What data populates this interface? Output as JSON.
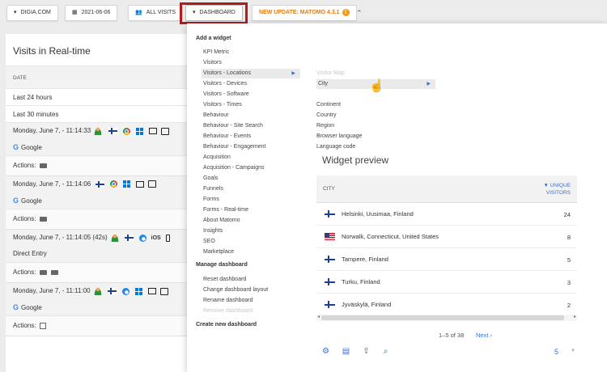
{
  "topbar": {
    "site": "DIGIA.COM",
    "date": "2021-06-06",
    "segment": "ALL VISITS",
    "dashboard": "DASHBOARD",
    "update": "NEW UPDATE: MATOMO 4.3.1",
    "update_badge": "!",
    "collapse_icon": "double-caret-up-icon",
    "colors": {
      "highlight": "#b01c1c",
      "update": "#e57b10"
    }
  },
  "visits": {
    "title": "Visits in Real-time",
    "column": "DATE",
    "rows": [
      "Last 24 hours",
      "Last 30 minutes"
    ],
    "entries": [
      {
        "time": "Monday, June 7, - 11:14:33",
        "referrer": "Google",
        "actions_label": "Actions:"
      },
      {
        "time": "Monday, June 7, - 11:14:06",
        "referrer": "Google",
        "actions_label": "Actions:"
      },
      {
        "time": "Monday, June 7, - 11:14:05 (42s)",
        "referrer": "Direct Entry",
        "os": "iOS",
        "actions_label": "Actions:"
      },
      {
        "time": "Monday, June 7, - 11:11:00",
        "referrer": "Google",
        "actions_label": "Actions:"
      }
    ]
  },
  "menu": {
    "add_widget": "Add a widget",
    "items": [
      "KPI Metric",
      "Visitors",
      "Visitors - Locations",
      "Visitors - Devices",
      "Visitors - Software",
      "Visitors - Times",
      "Behaviour",
      "Behaviour - Site Search",
      "Behaviour - Events",
      "Behaviour - Engagement",
      "Acquisition",
      "Acquisition - Campaigns",
      "Goals",
      "Funnels",
      "Forms",
      "Forms - Real-time",
      "About Matomo",
      "Insights",
      "SEO",
      "Marketplace"
    ],
    "manage_dashboard": "Manage dashboard",
    "manage_items": [
      "Reset dashboard",
      "Change dashboard layout",
      "Rename dashboard",
      "Remove dashboard"
    ],
    "create_new": "Create new dashboard",
    "submenu": [
      "Visitor Map",
      "City",
      "Continent",
      "Country",
      "Region",
      "Browser language",
      "Language code"
    ]
  },
  "preview": {
    "title": "Widget preview",
    "col_city": "CITY",
    "col_metric_1": "UNIQUE",
    "col_metric_2": "VISITORS",
    "rows": [
      {
        "flag": "finland-flag-icon",
        "city": "Helsinki, Uusimaa, Finland",
        "value": "24"
      },
      {
        "flag": "usa-flag-icon",
        "city": "Norwalk, Connecticut, United States",
        "value": "8"
      },
      {
        "flag": "finland-flag-icon",
        "city": "Tampere, Finland",
        "value": "5"
      },
      {
        "flag": "finland-flag-icon",
        "city": "Turku, Finland",
        "value": "3"
      },
      {
        "flag": "finland-flag-icon",
        "city": "Jyväskylä, Finland",
        "value": "2"
      }
    ],
    "pagination": "1–5 of 38",
    "next": "Next ›",
    "limit": "5"
  }
}
